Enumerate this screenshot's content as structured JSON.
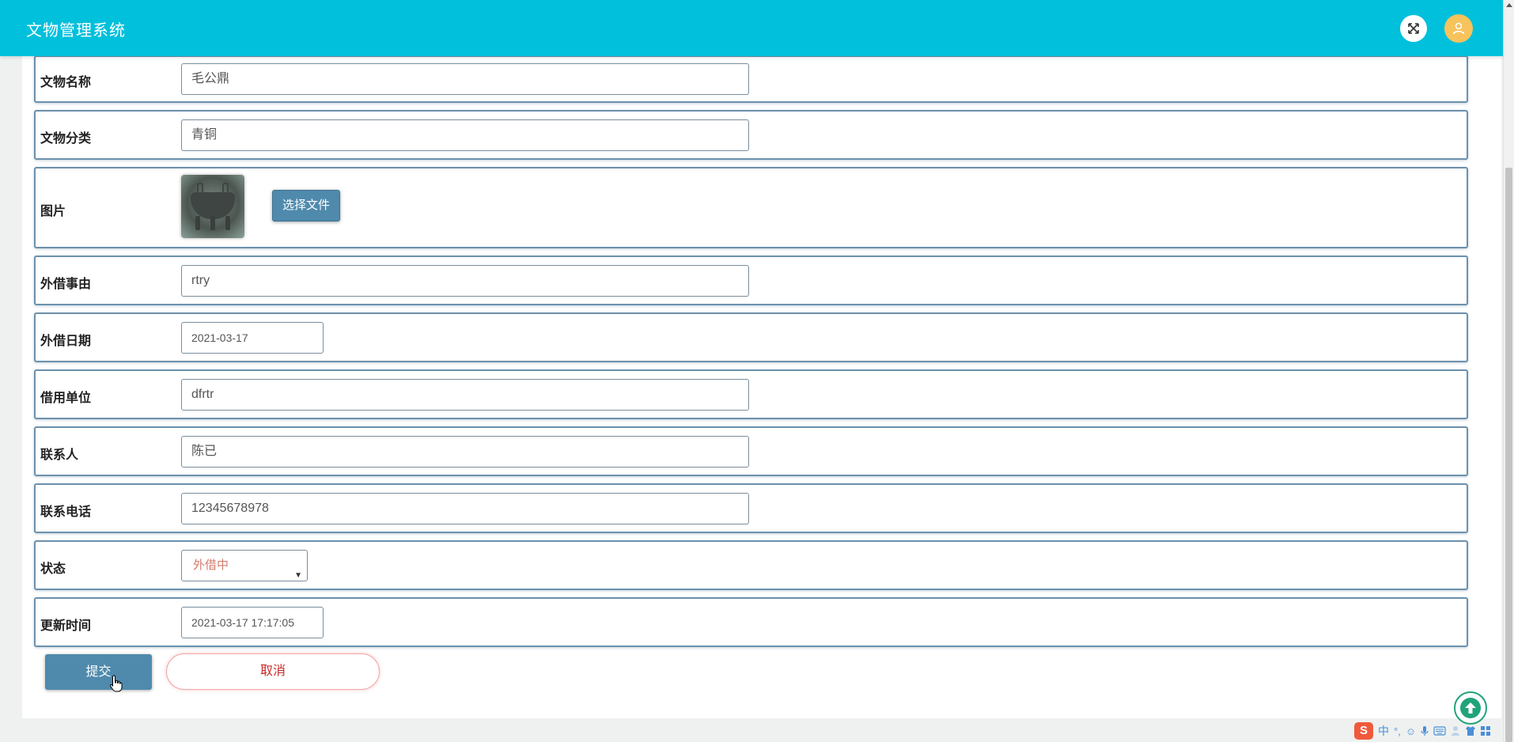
{
  "header": {
    "title": "文物管理系统",
    "fullscreen_icon": "fullscreen-expand-icon",
    "avatar_icon": "user-icon"
  },
  "form": {
    "name": {
      "label": "文物名称",
      "value": "毛公鼎"
    },
    "category": {
      "label": "文物分类",
      "value": "青铜"
    },
    "image": {
      "label": "图片",
      "button": "选择文件"
    },
    "reason": {
      "label": "外借事由",
      "value": "rtry"
    },
    "date": {
      "label": "外借日期",
      "value": "2021-03-17"
    },
    "borrower": {
      "label": "借用单位",
      "value": "dfrtr"
    },
    "contact": {
      "label": "联系人",
      "value": "陈已"
    },
    "phone": {
      "label": "联系电话",
      "value": "12345678978"
    },
    "status": {
      "label": "状态",
      "value": "外借中"
    },
    "updated": {
      "label": "更新时间",
      "value": "2021-03-17 17:17:05"
    }
  },
  "actions": {
    "submit": "提交",
    "cancel": "取消"
  },
  "ime": {
    "logo": "S",
    "mode": "中",
    "punct": "°,",
    "icons": [
      "emoji-icon",
      "microphone-icon",
      "keyboard-icon",
      "user-icon",
      "shirt-icon",
      "grid-icon"
    ]
  },
  "colors": {
    "header": "#00c0dc",
    "primary_button": "#4f8aad",
    "cancel_text": "#c92a2a",
    "status_text": "#d37b6d",
    "avatar": "#f7c35c"
  }
}
